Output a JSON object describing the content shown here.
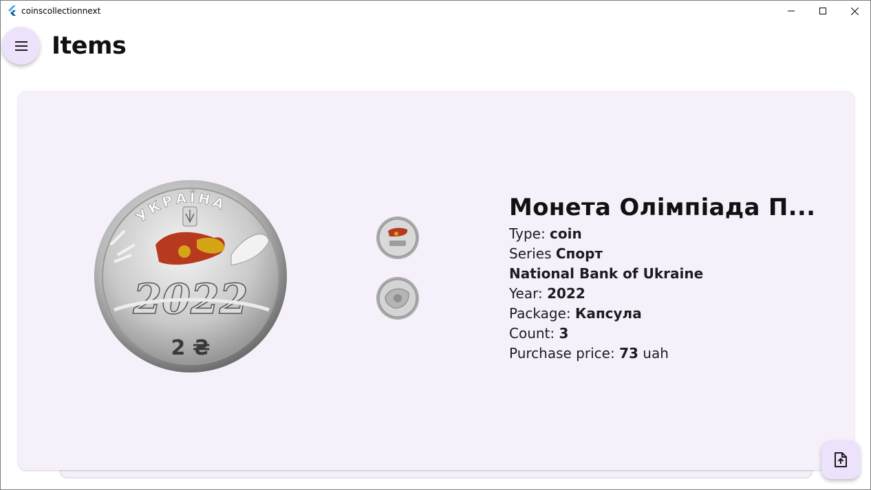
{
  "window": {
    "title": "coinscollectionnext"
  },
  "appbar": {
    "title": "Items",
    "menu_icon": "menu-icon"
  },
  "item": {
    "name": "Монета Олімпіада П...",
    "type_label": "Type: ",
    "type_value": "coin",
    "series_label": "Series ",
    "series_value": "Спорт",
    "issuer": "National Bank of Ukraine",
    "year_label": "Year: ",
    "year_value": "2022",
    "package_label": "Package: ",
    "package_value": "Капсула",
    "count_label": "Count: ",
    "count_value": "3",
    "price_label": "Purchase price: ",
    "price_value": "73",
    "price_currency": " uah"
  },
  "coin_art": {
    "top_text": "УКРАЇНА",
    "year": "2022",
    "denomination": "2 ₴"
  },
  "fab": {
    "icon": "file-upload-icon"
  },
  "colors": {
    "accent_container": "#ece2fb",
    "card_bg": "#f5f0fa"
  }
}
